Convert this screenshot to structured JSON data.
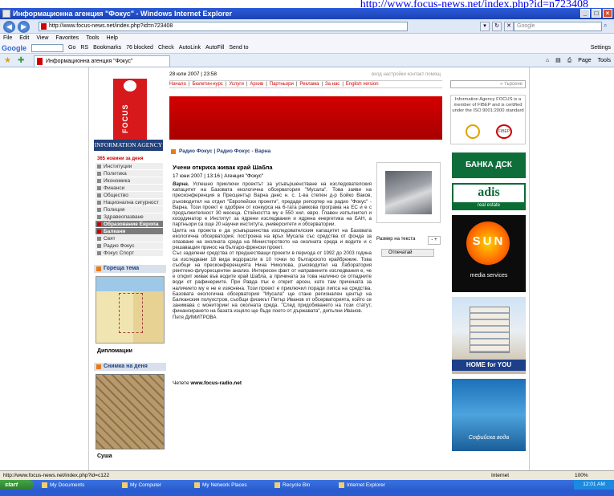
{
  "caption_url": "http://www.focus-news.net/index.php?id=n723408",
  "window": {
    "title": "Информационна агенция \"Фокус\" - Windows Internet Explorer"
  },
  "browser": {
    "address": "http://www.focus-news.net/index.php?id=n723408",
    "search_placeholder": "Google",
    "menu": [
      "File",
      "Edit",
      "View",
      "Favorites",
      "Tools",
      "Help"
    ],
    "google_toolbar": [
      "Google",
      "Go",
      "RS",
      "Bookmarks",
      "76 blocked",
      "Check",
      "AutoLink",
      "AutoFill",
      "Send to",
      "Settings"
    ],
    "tab_title": "Информационна агенция \"Фокус\"",
    "commands": [
      "Page",
      "Tools"
    ],
    "status_url": "http://www.focus-news.net/index.php?id=c122",
    "status_zone": "Internet",
    "zoom": "100%"
  },
  "site": {
    "logo_letter": "FOCUS",
    "logo_band": "INFORMATION AGENCY",
    "datetime": "28 юли 2007 | 23:58",
    "tools": "вход  настройки  контакт  помощ",
    "topnav": [
      "Начало",
      "Бюлетин-курс",
      "Услуги",
      "Архив",
      "Партньори",
      "Реклама",
      "За нас",
      "English version"
    ],
    "leftmenu_head": "365  новини за деня",
    "leftmenu": [
      "Институции",
      "Политика",
      "Икономика",
      "Финанси",
      "Общество",
      "Национална сигурност",
      "Полиция",
      "Здравеопазване",
      "Образование Европа и...",
      "Балкани",
      "Свят",
      "Радио Фокус",
      "Фокус Спорт"
    ],
    "leftmenu_active_index": 9,
    "hot_topic_head": "Гореща тема",
    "hot_topic_caption": "Дипломации",
    "photo_day_head": "Снимка на деня",
    "photo_day_caption": "Суша",
    "crumb": "Радио Фокус | Радио Фокус - Варна",
    "headline": "Учени откриха живак край Шабла",
    "meta": "17 юни 2007 | 13:16 | Агенция \"Фокус\"",
    "article_lead": "Варна.",
    "article_body": "Успешно приключи проектът за усъвършенстване на изследователския капацитет на Базовата екологична обсерватория \"Мусала\". Това заяви на пресконференция в Пресцентър Варна днес н. с. 1-ва степен д-р Бойко Ваков, ръководител на отдел \"Европейски проекти\", предаде репортер на радио \"Фокус\" - Варна. Този проект е одобрен от конкурса на 6-тата рамкова програма на ЕС и е с продължителност 30 месеца. Стойността му е 550 хил. евро. Главен изпълнител и координатор е Институт за ядрени изследвания и ядрена енергетика на БАН, а партньори са още 20 научни института, университети и обсерватории.",
    "article_body2": "Целта на проекта е да усъвършенства изследователския капацитет на Базовата екологична обсерватория, построена на връх Мусала със средства от фонда за опазване на околната среда на Министерството на околната среда и водите и с решаващия принос на българо-френски проект.",
    "article_body3": "Със заделени средства от предшестващи проекти в периода от 1992 до 2003 година са изследвани 18 вида водорасли в 10 точки по българското крайбрежие. Това съобщи на пресконференцията Нина Николова, ръководител на Лаборатория рентгено-флуоресцентен анализ. Интересен факт от направените изследвания е, че е открит живак във водите край Шабла, а причината за това налично се отпадните води от рафинериите. При Равда пък е открит арсен, като там причината за наличието му е не е изяснена. Този проект е приключил поради липса на средства. Базовата екологична обсерватория \"Мусала\" ще стане регионален център на Балканския полуостров, съобщи физикът Петър Иванов от обсерваторията, който се занимава с мониторинг на околната среда. \"След придобиването на този статут, финансирането на базата изцяло ще бъде поето от държавата\", допълни Иванов.",
    "author": "Петя ДИМИТРОВА",
    "read_more_prefix": "Четете ",
    "read_more_link": "www.focus-radio.net",
    "font_size_label": "Размер на текста",
    "font_size_ctl": "- +",
    "print_label": "Отпечатай",
    "right_search": "» търсене",
    "iso_text": "Information Agency FOCUS is a member of FIBEP and is certified under the ISO 9001:2000 standard",
    "iso_badge": "FIBEP",
    "ads": {
      "bank": "БАНКА ДСК",
      "adis": "adis",
      "adis_sub": "real estate",
      "sun": "SUN",
      "sun_sub": "media services",
      "home": "HOME for YOU",
      "water": "Софийска вода"
    }
  },
  "taskbar": {
    "start": "start",
    "items": [
      "My Documents",
      "My Computer",
      "My Network Places",
      "Recycle Bin",
      "Internet Explorer"
    ],
    "clock": "12:01 AM"
  }
}
